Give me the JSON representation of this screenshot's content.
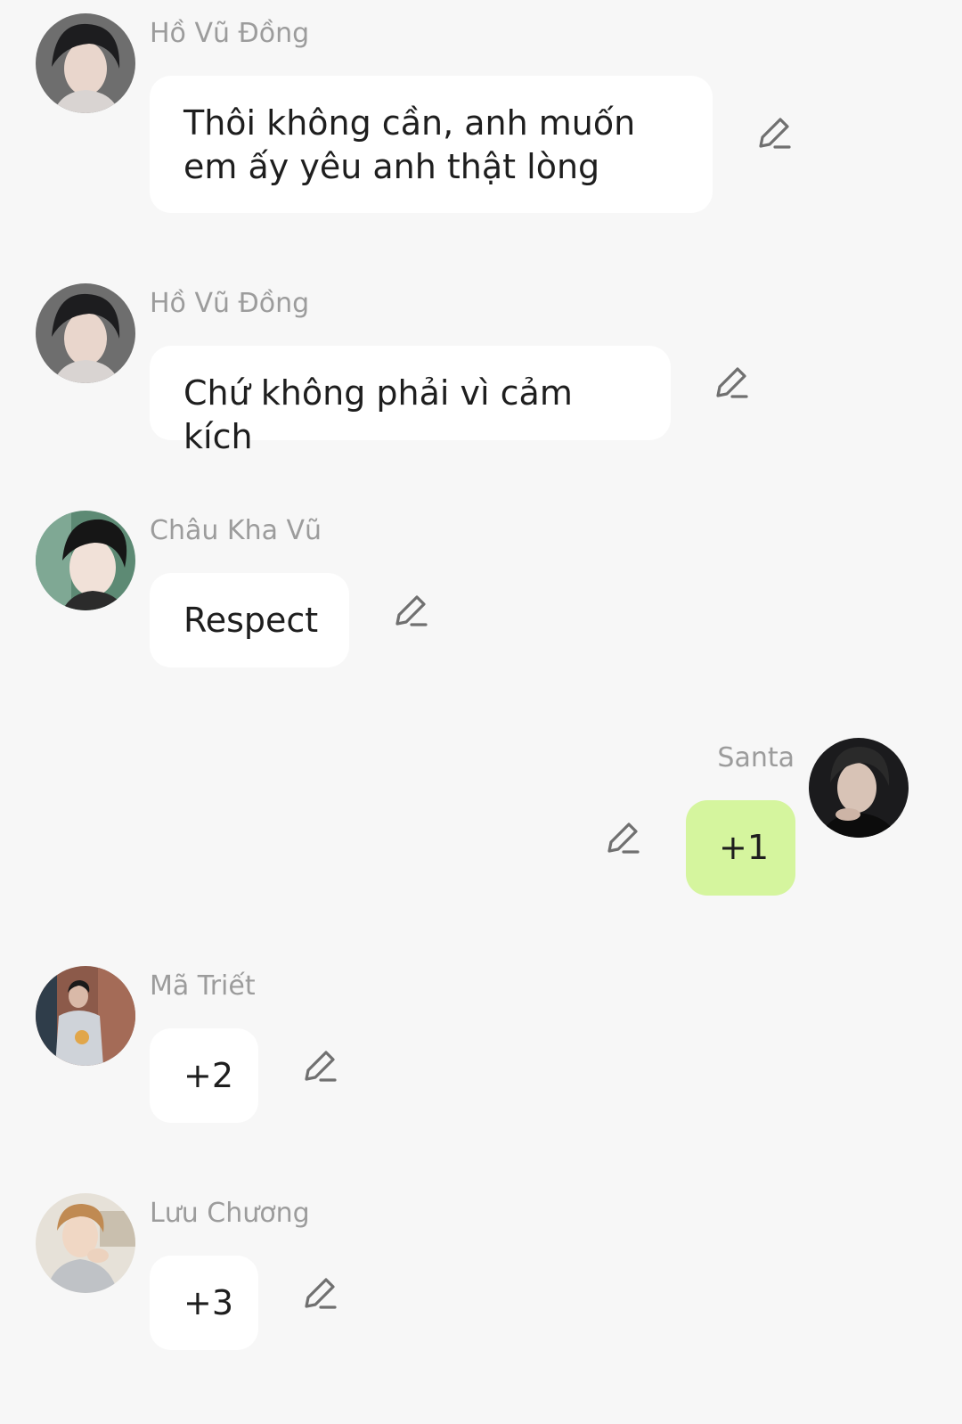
{
  "messages": [
    {
      "sender": "Hồ Vũ Đồng",
      "text": "Thôi không cần, anh muốn em ấy yêu anh thật lòng",
      "side": "left",
      "avatar_icon": "profile-photo"
    },
    {
      "sender": "Hồ Vũ Đồng",
      "text": "Chứ không phải vì cảm kích",
      "side": "left",
      "avatar_icon": "profile-photo"
    },
    {
      "sender": "Châu Kha Vũ",
      "text": "Respect",
      "side": "left",
      "avatar_icon": "profile-photo"
    },
    {
      "sender": "Santa",
      "text": "+1",
      "side": "right",
      "avatar_icon": "profile-photo"
    },
    {
      "sender": "Mã Triết",
      "text": "+2",
      "side": "left",
      "avatar_icon": "profile-photo"
    },
    {
      "sender": "Lưu Chương",
      "text": "+3",
      "side": "left",
      "avatar_icon": "profile-photo"
    }
  ],
  "icons": {
    "edit": "pencil-edit-icon"
  },
  "colors": {
    "background": "#f7f7f7",
    "bubble_other": "#ffffff",
    "bubble_mine": "#d5f59e",
    "sender_name": "#9c9c9c",
    "message_text": "#1e1e1e"
  }
}
